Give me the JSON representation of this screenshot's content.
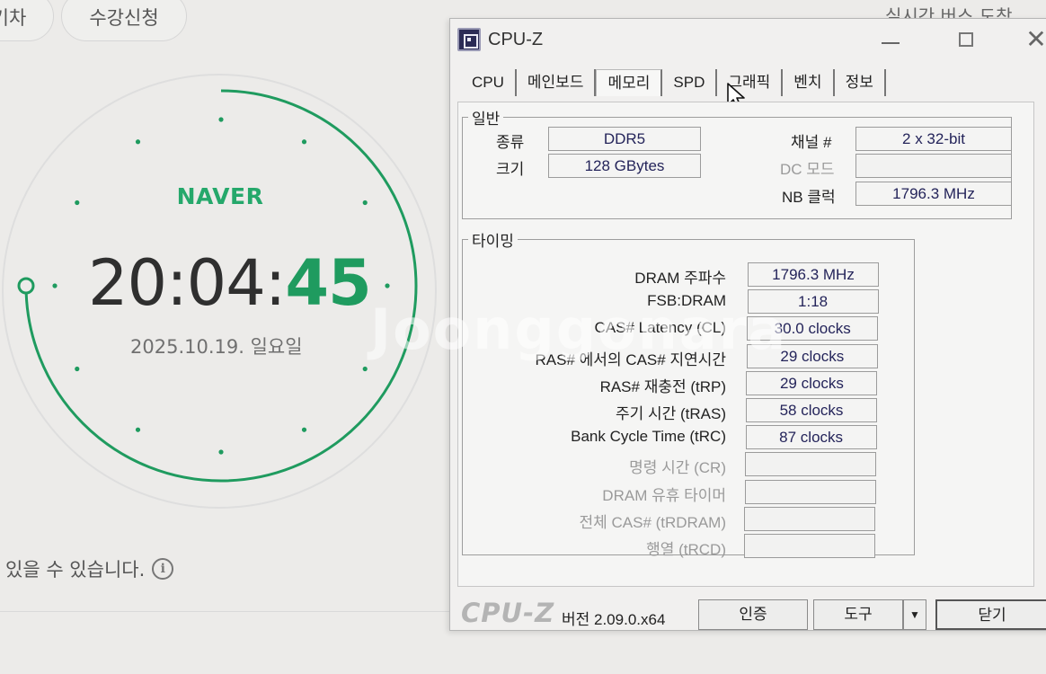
{
  "background": {
    "top_buttons": [
      "기차",
      "수강신청"
    ],
    "top_right_text": "실시간 버스 도착",
    "bottom_note": "있을 수 있습니다.",
    "watermark": "Joonggonara"
  },
  "clock": {
    "logo": "NAVER",
    "hours_minutes": "20:04:",
    "seconds": "45",
    "date": "2025.10.19. 일요일",
    "seconds_progress": 0.75,
    "accent_color": "#1f9b5f"
  },
  "cpuz": {
    "title": "CPU-Z",
    "tabs": [
      {
        "label": "CPU",
        "active": false
      },
      {
        "label": "메인보드",
        "active": false
      },
      {
        "label": "메모리",
        "active": true
      },
      {
        "label": "SPD",
        "active": false
      },
      {
        "label": "그래픽",
        "active": false
      },
      {
        "label": "벤치",
        "active": false
      },
      {
        "label": "정보",
        "active": false
      }
    ],
    "general": {
      "legend": "일반",
      "type_label": "종류",
      "type_value": "DDR5",
      "size_label": "크기",
      "size_value": "128 GBytes",
      "channel_label": "채널 #",
      "channel_value": "2 x 32-bit",
      "dc_mode_label": "DC 모드",
      "dc_mode_value": "",
      "nb_clock_label": "NB 클럭",
      "nb_clock_value": "1796.3 MHz"
    },
    "timing": {
      "legend": "타이밍",
      "rows": [
        {
          "label": "DRAM 주파수",
          "value": "1796.3 MHz",
          "enabled": true
        },
        {
          "label": "FSB:DRAM",
          "value": "1:18",
          "enabled": true
        },
        {
          "label": "CAS# Latency (CL)",
          "value": "30.0 clocks",
          "enabled": true
        },
        {
          "label": "RAS# 에서의 CAS# 지연시간",
          "value": "29 clocks",
          "enabled": true
        },
        {
          "label": "RAS# 재충전 (tRP)",
          "value": "29 clocks",
          "enabled": true
        },
        {
          "label": "주기 시간 (tRAS)",
          "value": "58 clocks",
          "enabled": true
        },
        {
          "label": "Bank Cycle Time (tRC)",
          "value": "87 clocks",
          "enabled": true
        },
        {
          "label": "명령 시간 (CR)",
          "value": "",
          "enabled": false
        },
        {
          "label": "DRAM 유휴 타이머",
          "value": "",
          "enabled": false
        },
        {
          "label": "전체 CAS# (tRDRAM)",
          "value": "",
          "enabled": false
        },
        {
          "label": "행열 (tRCD)",
          "value": "",
          "enabled": false
        }
      ]
    },
    "footer": {
      "logo": "CPU-Z",
      "version": "버전 2.09.0.x64",
      "validate_label": "인증",
      "tools_label": "도구",
      "close_label": "닫기"
    }
  }
}
